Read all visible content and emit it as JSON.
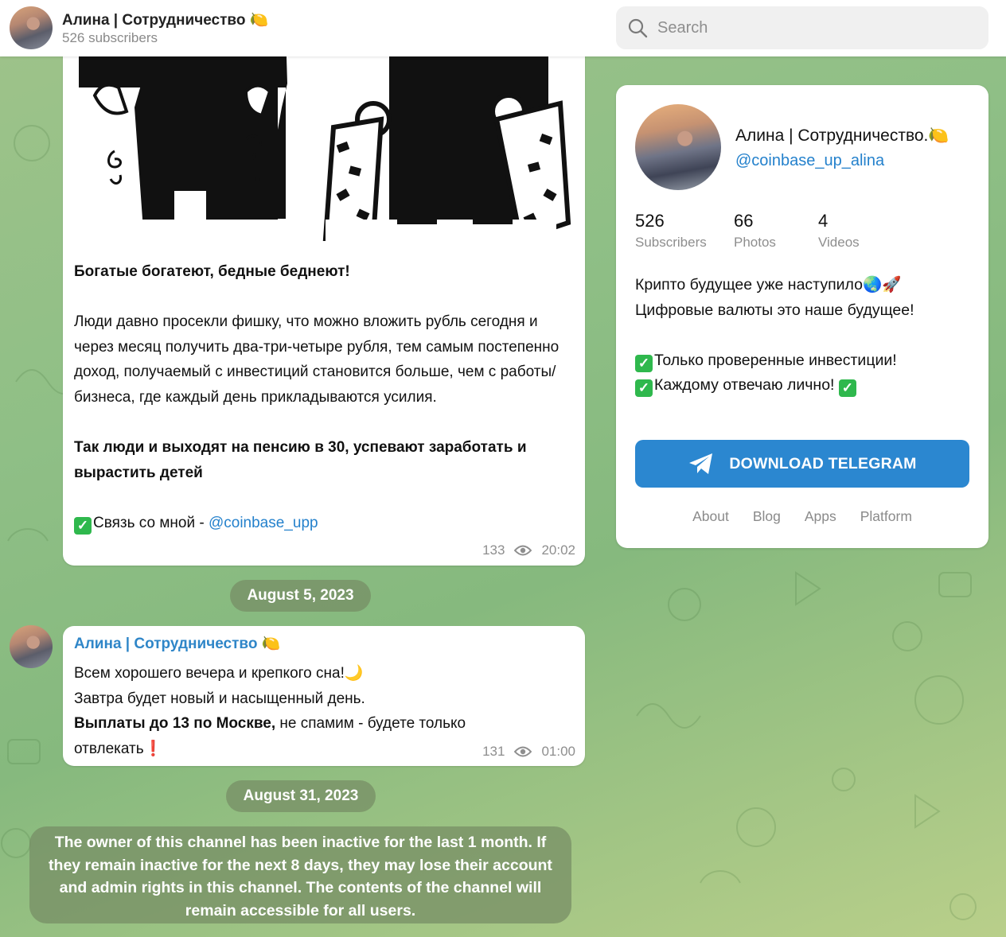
{
  "header": {
    "channel_title": "Алина | Сотрудничество 🍋",
    "subscribers_line": "526 subscribers",
    "search_placeholder": "Search"
  },
  "message1": {
    "heading": "Богатые богатеют, бедные беднеют!",
    "paragraph": "Люди давно просекли фишку, что можно вложить рубль сегодня и через месяц получить два-три-четыре рубля, тем самым постепенно доход, получаемый с инвестиций становится больше, чем с работы/ бизнеса, где каждый день прикладываются усилия.",
    "bold_line": "Так люди и выходят на пенсию в 30, успевают заработать и вырастить детей",
    "contact_prefix": "Связь со мной - ",
    "contact_link": "@coinbase_upp",
    "views": "133",
    "time": "20:02"
  },
  "date1": "August 5, 2023",
  "message2": {
    "author": "Алина | Сотрудничество 🍋",
    "line1": "Всем хорошего вечера и крепкого сна!🌙",
    "line2": "Завтра будет новый и насыщенный день.",
    "line3_bold": "Выплаты до 13 по Москве,",
    "line3_rest": " не спамим - будете только отвлекать❗",
    "views": "131",
    "time": "01:00"
  },
  "date2": "August 31, 2023",
  "notice": "The owner of this channel has been inactive for the last 1 month. If they remain inactive for the next 8 days, they may lose their account and admin rights in this channel. The contents of the channel will remain accessible for all users.",
  "card": {
    "name": "Алина | Сотрудничество.🍋",
    "handle": "@coinbase_up_alina",
    "stats": [
      {
        "num": "526",
        "label": "Subscribers"
      },
      {
        "num": "66",
        "label": "Photos"
      },
      {
        "num": "4",
        "label": "Videos"
      }
    ],
    "desc_line1": "Крипто будущее уже наступило🌏🚀",
    "desc_line2": "Цифровые валюты это наше будущее!",
    "desc_check1": "Только проверенные инвестиции!",
    "desc_check2": "Каждому отвечаю лично! ",
    "download_label": "DOWNLOAD TELEGRAM",
    "links": [
      "About",
      "Blog",
      "Apps",
      "Platform"
    ]
  },
  "colors": {
    "accent": "#2b87d0",
    "link": "#2481cc",
    "check_green": "#2fb84d",
    "pill_bg": "#768c64"
  }
}
